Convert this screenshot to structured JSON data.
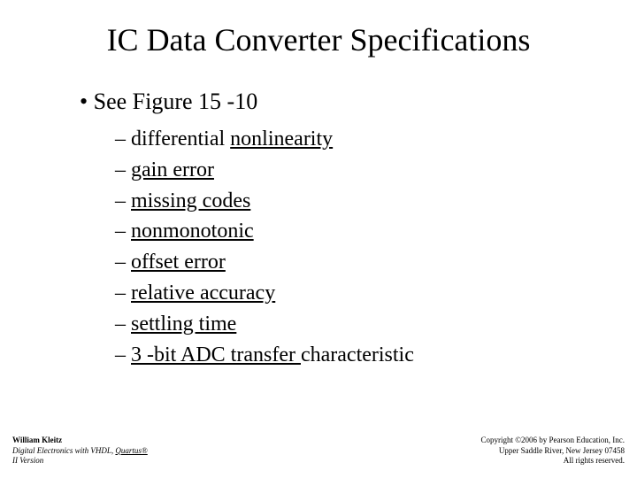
{
  "title": "IC Data Converter Specifications",
  "bullet1": "See Figure 15 -10",
  "items": [
    {
      "plain_before": "differential ",
      "link": "nonlinearity",
      "plain_after": ""
    },
    {
      "plain_before": "",
      "link": "gain error",
      "plain_after": ""
    },
    {
      "plain_before": "",
      "link": "missing codes",
      "plain_after": ""
    },
    {
      "plain_before": "",
      "link": "nonmonotonic",
      "plain_after": ""
    },
    {
      "plain_before": "",
      "link": "offset error",
      "plain_after": ""
    },
    {
      "plain_before": "",
      "link": "relative accuracy",
      "plain_after": ""
    },
    {
      "plain_before": "",
      "link": "settling time",
      "plain_after": ""
    },
    {
      "plain_before": "",
      "link": "3 -bit ADC transfer ",
      "plain_after": "characteristic"
    }
  ],
  "footer_left": {
    "author": "William Kleitz",
    "line2_a": "Digital Electronics with VHDL, ",
    "line2_b": "Quartus®",
    "line3": "II Version"
  },
  "footer_right": {
    "line1": "Copyright ©2006 by Pearson Education, Inc.",
    "line2": "Upper Saddle River, New Jersey 07458",
    "line3": "All rights reserved."
  }
}
